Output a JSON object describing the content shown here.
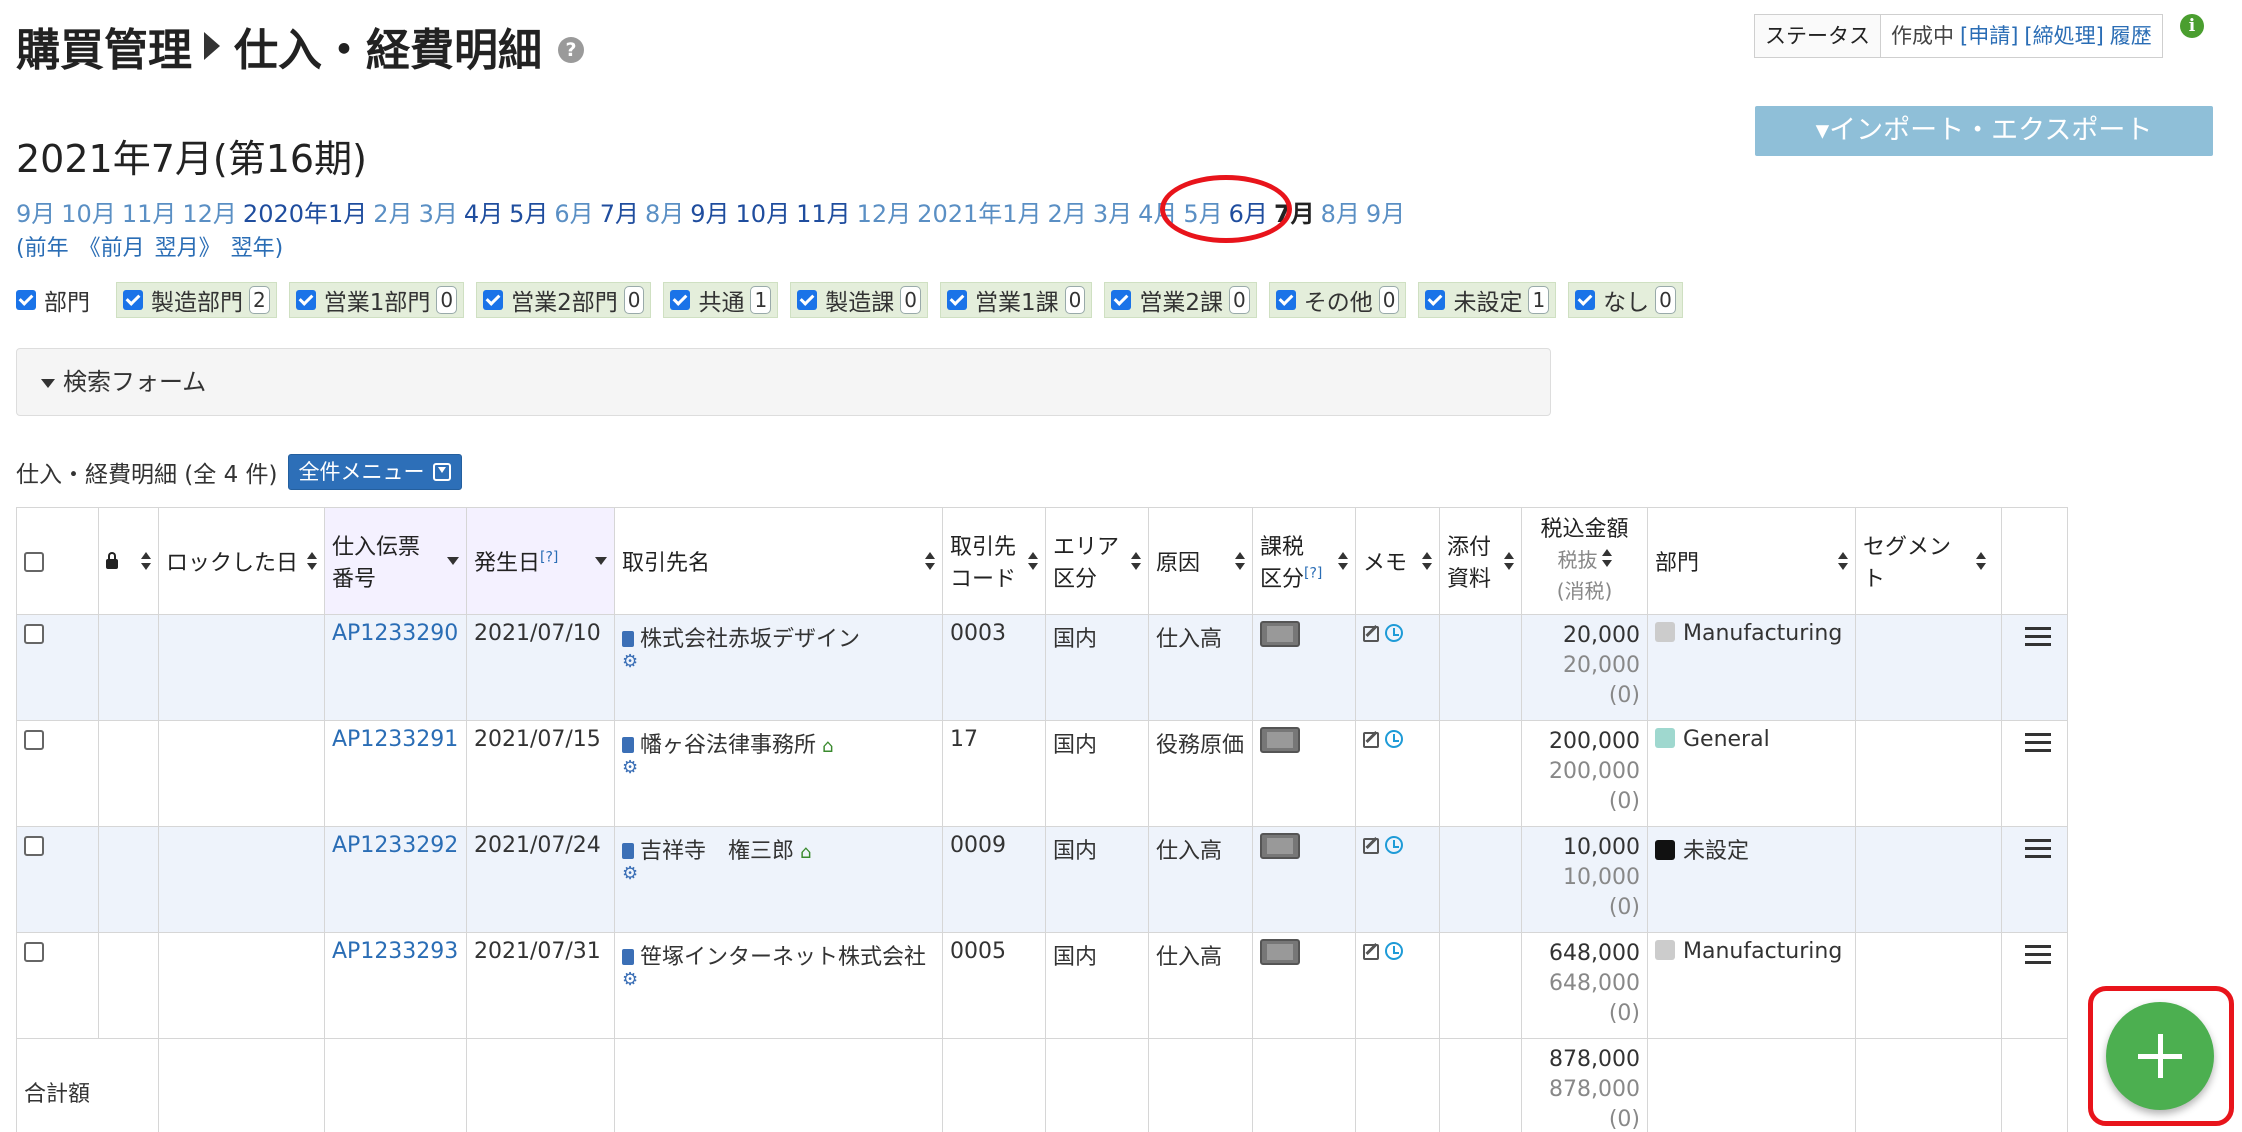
{
  "header": {
    "breadcrumb_parent": "購買管理",
    "breadcrumb_current": "仕入・経費明細",
    "help": "?"
  },
  "status": {
    "label": "ステータス",
    "value": "作成中",
    "links": [
      "[申請]",
      "[締処理]",
      "履歴"
    ],
    "info": "i"
  },
  "import_export_label": "▾インポート・エクスポート",
  "period_title": "2021年7月(第16期)",
  "months": [
    {
      "label": "9月",
      "style": "lightlink"
    },
    {
      "label": "10月",
      "style": "lightlink"
    },
    {
      "label": "11月",
      "style": "lightlink"
    },
    {
      "label": "12月",
      "style": "lightlink"
    },
    {
      "label": "2020年1月",
      "style": "darklink"
    },
    {
      "label": "2月",
      "style": "lightlink"
    },
    {
      "label": "3月",
      "style": "lightlink"
    },
    {
      "label": "4月",
      "style": "darklink"
    },
    {
      "label": "5月",
      "style": "darklink"
    },
    {
      "label": "6月",
      "style": "lightlink"
    },
    {
      "label": "7月",
      "style": "darklink"
    },
    {
      "label": "8月",
      "style": "lightlink"
    },
    {
      "label": "9月",
      "style": "darklink"
    },
    {
      "label": "10月",
      "style": "darklink"
    },
    {
      "label": "11月",
      "style": "darklink"
    },
    {
      "label": "12月",
      "style": "lightlink"
    },
    {
      "label": "2021年1月",
      "style": "lightlink"
    },
    {
      "label": "2月",
      "style": "lightlink"
    },
    {
      "label": "3月",
      "style": "lightlink"
    },
    {
      "label": "4月",
      "style": "lightlink"
    },
    {
      "label": "5月",
      "style": "lightlink"
    },
    {
      "label": "6月",
      "style": "darklink"
    },
    {
      "label": "7月",
      "style": "cur"
    },
    {
      "label": "8月",
      "style": "lightlink"
    },
    {
      "label": "9月",
      "style": "lightlink"
    }
  ],
  "nav": {
    "prev_year": "(前年",
    "prev_month": "《前月",
    "next_month": "翌月》",
    "next_year": "翌年)"
  },
  "departments": {
    "label": "部門",
    "chips": [
      {
        "name": "製造部門",
        "count": "2"
      },
      {
        "name": "営業1部門",
        "count": "0"
      },
      {
        "name": "営業2部門",
        "count": "0"
      },
      {
        "name": "共通",
        "count": "1"
      },
      {
        "name": "製造課",
        "count": "0"
      },
      {
        "name": "営業1課",
        "count": "0"
      },
      {
        "name": "営業2課",
        "count": "0"
      },
      {
        "name": "その他",
        "count": "0"
      },
      {
        "name": "未設定",
        "count": "1"
      },
      {
        "name": "なし",
        "count": "0"
      }
    ]
  },
  "search_form_label": "検索フォーム",
  "list": {
    "title": "仕入・経費明細 (全 4 件)",
    "menu_button": "全件メニュー"
  },
  "table": {
    "headers": {
      "locked_date": "ロックした日",
      "slip_no_1": "仕入伝票",
      "slip_no_2": "番号",
      "date": "発生日",
      "help_mark": "[?]",
      "partner": "取引先名",
      "partner_code_1": "取引先",
      "partner_code_2": "コード",
      "area_1": "エリア",
      "area_2": "区分",
      "cause": "原因",
      "tax_1": "課税",
      "tax_2": "区分",
      "memo": "メモ",
      "attach_1": "添付",
      "attach_2": "資料",
      "amount_1": "税込金額",
      "amount_2": "税抜",
      "amount_3": "(消税)",
      "department": "部門",
      "segment": "セグメント"
    },
    "rows": [
      {
        "slip": "AP1233290",
        "date": "2021/07/10",
        "partner": "株式会社赤坂デザイン",
        "home": false,
        "code": "0003",
        "area": "国内",
        "cause": "仕入高",
        "amount": "20,000",
        "net": "20,000",
        "tax": "(0)",
        "dept": "Manufacturing",
        "dept_color": "#cccccc"
      },
      {
        "slip": "AP1233291",
        "date": "2021/07/15",
        "partner": "幡ヶ谷法律事務所",
        "home": true,
        "code": "17",
        "area": "国内",
        "cause": "役務原価",
        "amount": "200,000",
        "net": "200,000",
        "tax": "(0)",
        "dept": "General",
        "dept_color": "#9fd8cf"
      },
      {
        "slip": "AP1233292",
        "date": "2021/07/24",
        "partner": "吉祥寺　権三郎",
        "home": true,
        "code": "0009",
        "area": "国内",
        "cause": "仕入高",
        "amount": "10,000",
        "net": "10,000",
        "tax": "(0)",
        "dept": "未設定",
        "dept_color": "#111111"
      },
      {
        "slip": "AP1233293",
        "date": "2021/07/31",
        "partner": "笹塚インターネット株式会社",
        "home": false,
        "code": "0005",
        "area": "国内",
        "cause": "仕入高",
        "amount": "648,000",
        "net": "648,000",
        "tax": "(0)",
        "dept": "Manufacturing",
        "dept_color": "#cccccc"
      }
    ],
    "total": {
      "label": "合計額",
      "amount": "878,000",
      "net": "878,000",
      "tax": "(0)"
    }
  }
}
